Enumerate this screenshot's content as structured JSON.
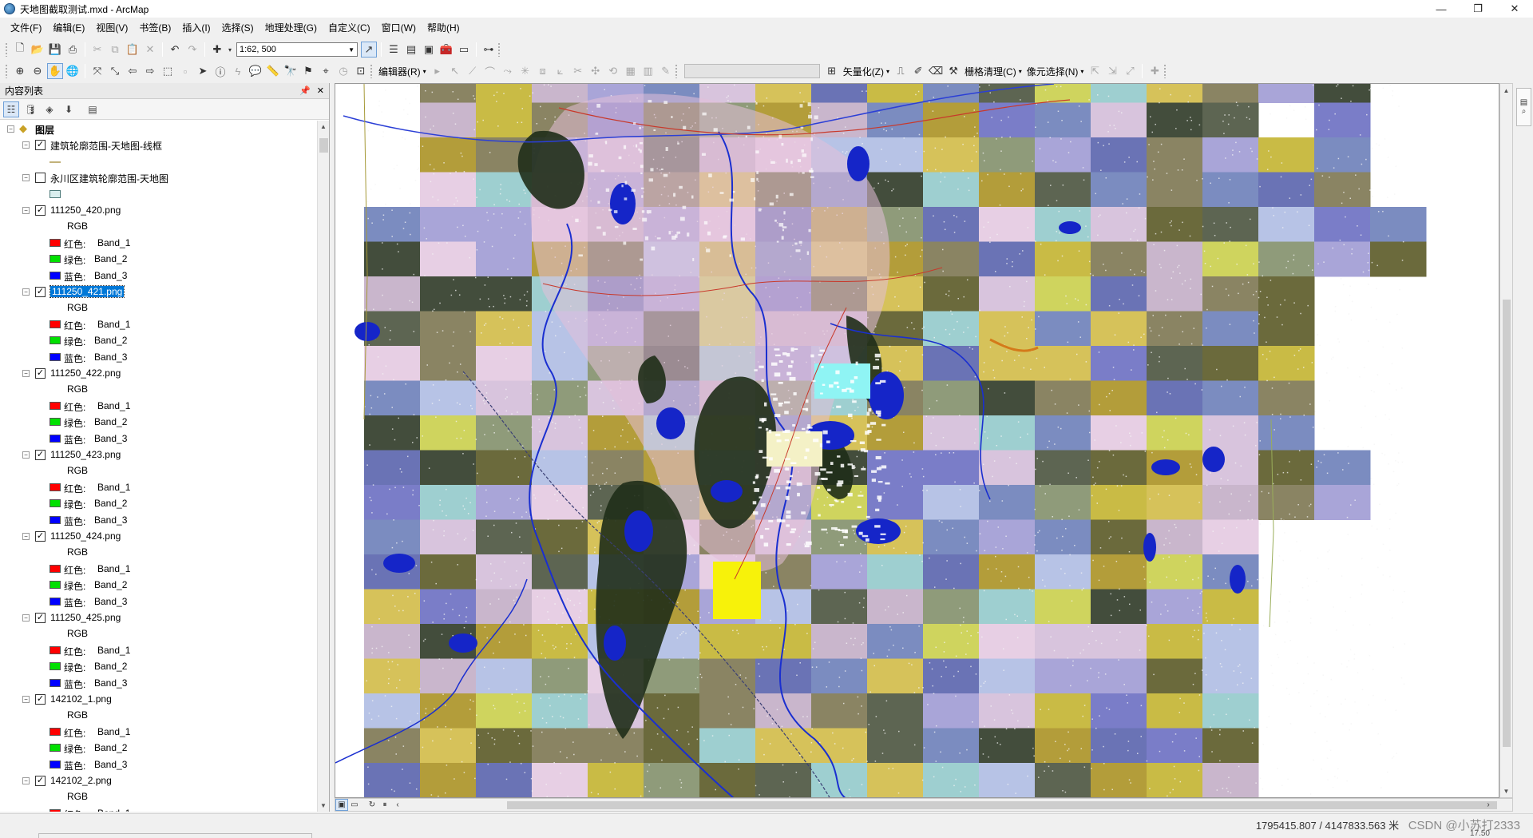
{
  "window": {
    "title": "天地图截取测试.mxd - ArcMap",
    "minimize_icon": "minimize-icon",
    "maximize_icon": "restore-icon",
    "close_icon": "close-icon"
  },
  "menu": [
    "文件(F)",
    "编辑(E)",
    "视图(V)",
    "书签(B)",
    "插入(I)",
    "选择(S)",
    "地理处理(G)",
    "自定义(C)",
    "窗口(W)",
    "帮助(H)"
  ],
  "toolbar1": {
    "scale": "1:62, 500"
  },
  "toolbar2": {
    "editor_label": "编辑器(R)",
    "vectorize_label": "矢量化(Z)",
    "raster_cleanup_label": "栅格清理(C)",
    "pixel_select_label": "像元选择(N)"
  },
  "toc": {
    "title": "内容列表",
    "pin_icon": "pin-icon",
    "close_icon": "close-icon",
    "root_label": "图层",
    "layers": [
      {
        "name": "建筑轮廓范围-天地图-线框",
        "checked": true,
        "symbol": "line"
      },
      {
        "name": "永川区建筑轮廓范围-天地图",
        "checked": false,
        "symbol": "polygon"
      },
      {
        "name": "111250_420.png",
        "checked": true,
        "symbol": "rgb",
        "selected": false
      },
      {
        "name": "111250_421.png",
        "checked": true,
        "symbol": "rgb",
        "selected": true
      },
      {
        "name": "111250_422.png",
        "checked": true,
        "symbol": "rgb",
        "selected": false
      },
      {
        "name": "111250_423.png",
        "checked": true,
        "symbol": "rgb",
        "selected": false
      },
      {
        "name": "111250_424.png",
        "checked": true,
        "symbol": "rgb",
        "selected": false
      },
      {
        "name": "111250_425.png",
        "checked": true,
        "symbol": "rgb",
        "selected": false
      },
      {
        "name": "142102_1.png",
        "checked": true,
        "symbol": "rgb",
        "selected": false
      },
      {
        "name": "142102_2.png",
        "checked": true,
        "symbol": "rgb",
        "selected": false
      }
    ],
    "rgb_label": "RGB",
    "bands": [
      {
        "channel": "红色:",
        "band": "Band_1",
        "color": "#ff0000"
      },
      {
        "channel": "绿色:",
        "band": "Band_2",
        "color": "#00e000"
      },
      {
        "channel": "蓝色:",
        "band": "Band_3",
        "color": "#0000ff"
      }
    ]
  },
  "status": {
    "coordinates": "1795415.807 / 4147833.563 米",
    "watermark": "CSDN @小苏打2333",
    "secondary": "17.50"
  },
  "map": {
    "tile_colors": [
      "#6b6a3c",
      "#d6c25a",
      "#c9b6cc",
      "#7a7dc8",
      "#a9a5d8",
      "#5d6552",
      "#b7c3e6",
      "#7b8cc0",
      "#8a8463",
      "#d8c4dd",
      "#c9bb45",
      "#9ecfd0",
      "#434d3c",
      "#e7cfe4",
      "#cfd45e",
      "#6a73b5",
      "#8f9b7a",
      "#b39d3a"
    ]
  }
}
